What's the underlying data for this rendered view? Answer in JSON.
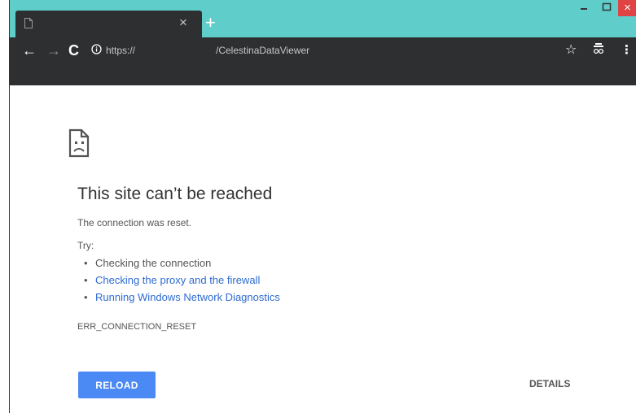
{
  "tab": {
    "title": "",
    "page_icon": "page-icon",
    "close_icon": "close-icon",
    "close_glyph": "×",
    "new_tab_glyph": "+"
  },
  "window_controls": {
    "minimize_glyph": "–",
    "maximize_glyph": "□",
    "close_glyph": "×"
  },
  "toolbar": {
    "back_glyph": "←",
    "forward_glyph": "→",
    "reload_glyph": "C",
    "url_scheme": "https://",
    "url_path": "/CelestinaDataViewer",
    "star_glyph": "☆",
    "menu_glyph": "⋮"
  },
  "error": {
    "title": "This site can’t be reached",
    "message": "The connection was reset.",
    "try_label": "Try:",
    "suggestions": [
      "Checking the connection",
      "Checking the proxy and the firewall",
      "Running Windows Network Diagnostics"
    ],
    "code": "ERR_CONNECTION_RESET"
  },
  "buttons": {
    "reload": "RELOAD",
    "details": "DETAILS"
  },
  "colors": {
    "titlebar": "#5fcdc9",
    "toolbar": "#2d2f31",
    "link": "#2d6ad1",
    "reload_button": "#4b8af4",
    "close_button": "#e04343"
  }
}
